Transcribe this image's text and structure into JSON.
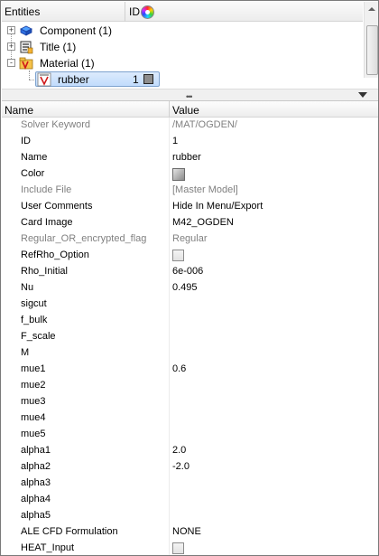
{
  "tree": {
    "header": {
      "entities": "Entities",
      "id": "ID",
      "color_icon": "color-wheel-icon"
    },
    "items": [
      {
        "label": "Component (1)",
        "icon": "component-icon",
        "expander": "+"
      },
      {
        "label": "Title (1)",
        "icon": "title-icon",
        "expander": "+"
      },
      {
        "label": "Material (1)",
        "icon": "material-icon",
        "expander": "-"
      },
      {
        "label": "rubber",
        "icon": "material-icon",
        "id": "1",
        "selected": true
      }
    ]
  },
  "splitter": {
    "grip": "•••"
  },
  "table": {
    "headers": {
      "name": "Name",
      "value": "Value"
    },
    "rows": [
      {
        "name": "Solver Keyword",
        "value": "/MAT/OGDEN/",
        "readonly": true
      },
      {
        "name": "ID",
        "value": "1"
      },
      {
        "name": "Name",
        "value": "rubber"
      },
      {
        "name": "Color",
        "value": "",
        "widget": "color"
      },
      {
        "name": "Include File",
        "value": "[Master Model]",
        "readonly": true
      },
      {
        "name": "User Comments",
        "value": "Hide In Menu/Export"
      },
      {
        "name": "Card Image",
        "value": "M42_OGDEN"
      },
      {
        "name": "Regular_OR_encrypted_flag",
        "value": "Regular",
        "readonly": true
      },
      {
        "name": "RefRho_Option",
        "value": "",
        "widget": "checkbox"
      },
      {
        "name": "Rho_Initial",
        "value": "6e-006"
      },
      {
        "name": "Nu",
        "value": "0.495"
      },
      {
        "name": "sigcut",
        "value": ""
      },
      {
        "name": "f_bulk",
        "value": ""
      },
      {
        "name": "F_scale",
        "value": ""
      },
      {
        "name": "M",
        "value": ""
      },
      {
        "name": "mue1",
        "value": "0.6"
      },
      {
        "name": "mue2",
        "value": ""
      },
      {
        "name": "mue3",
        "value": ""
      },
      {
        "name": "mue4",
        "value": ""
      },
      {
        "name": "mue5",
        "value": ""
      },
      {
        "name": "alpha1",
        "value": "2.0"
      },
      {
        "name": "alpha2",
        "value": "-2.0"
      },
      {
        "name": "alpha3",
        "value": ""
      },
      {
        "name": "alpha4",
        "value": ""
      },
      {
        "name": "alpha5",
        "value": ""
      },
      {
        "name": "ALE CFD Formulation",
        "value": "NONE"
      },
      {
        "name": "HEAT_Input",
        "value": "",
        "widget": "checkbox"
      }
    ]
  }
}
